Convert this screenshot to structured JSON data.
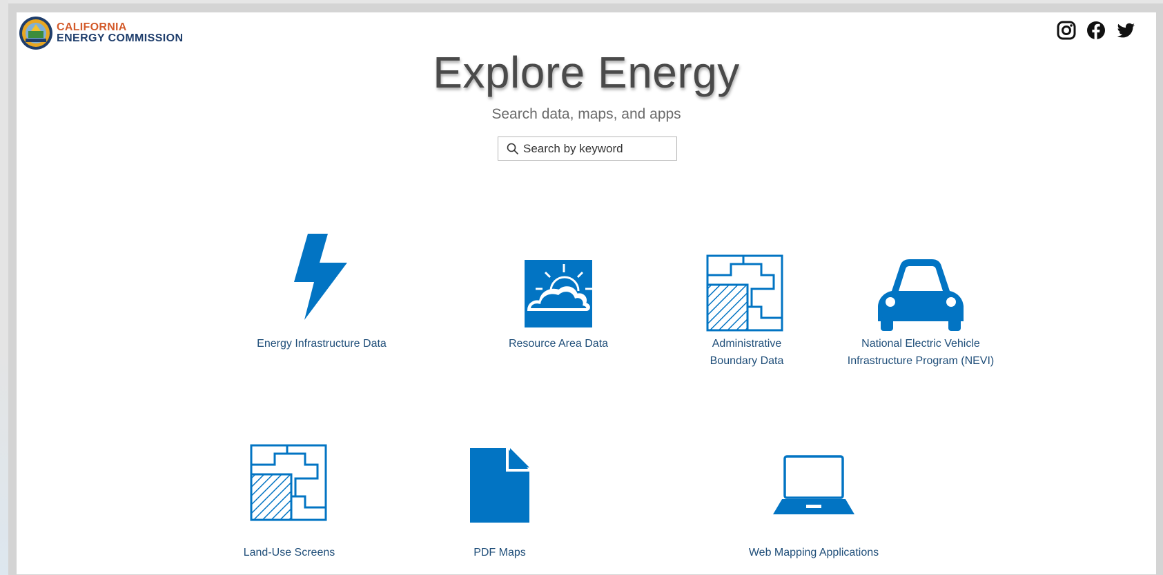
{
  "header": {
    "logo_line1": "CALIFORNIA",
    "logo_line2": "ENERGY COMMISSION",
    "social_icons": [
      "instagram-icon",
      "facebook-icon",
      "twitter-icon"
    ]
  },
  "hero": {
    "title": "Explore Energy",
    "subtitle": "Search data, maps, and apps"
  },
  "search": {
    "placeholder": "Search by keyword",
    "value": ""
  },
  "tiles": [
    {
      "label": "Energy Infrastructure Data",
      "icon": "lightning-bolt-icon"
    },
    {
      "label": "Resource Area Data",
      "icon": "sun-cloud-icon"
    },
    {
      "label": "Administrative Boundary Data",
      "icon": "parcel-boundary-icon"
    },
    {
      "label": "National Electric Vehicle Infrastructure Program (NEVI)",
      "icon": "car-icon"
    },
    {
      "label": "Land-Use Screens",
      "icon": "parcel-boundary-icon"
    },
    {
      "label": "PDF Maps",
      "icon": "document-icon"
    },
    {
      "label": "Web Mapping Applications",
      "icon": "laptop-icon"
    }
  ],
  "colors": {
    "accent": "#0274c3",
    "label": "#1f4e79",
    "logo_orange": "#d35a2a",
    "logo_navy": "#1f3e6c"
  }
}
